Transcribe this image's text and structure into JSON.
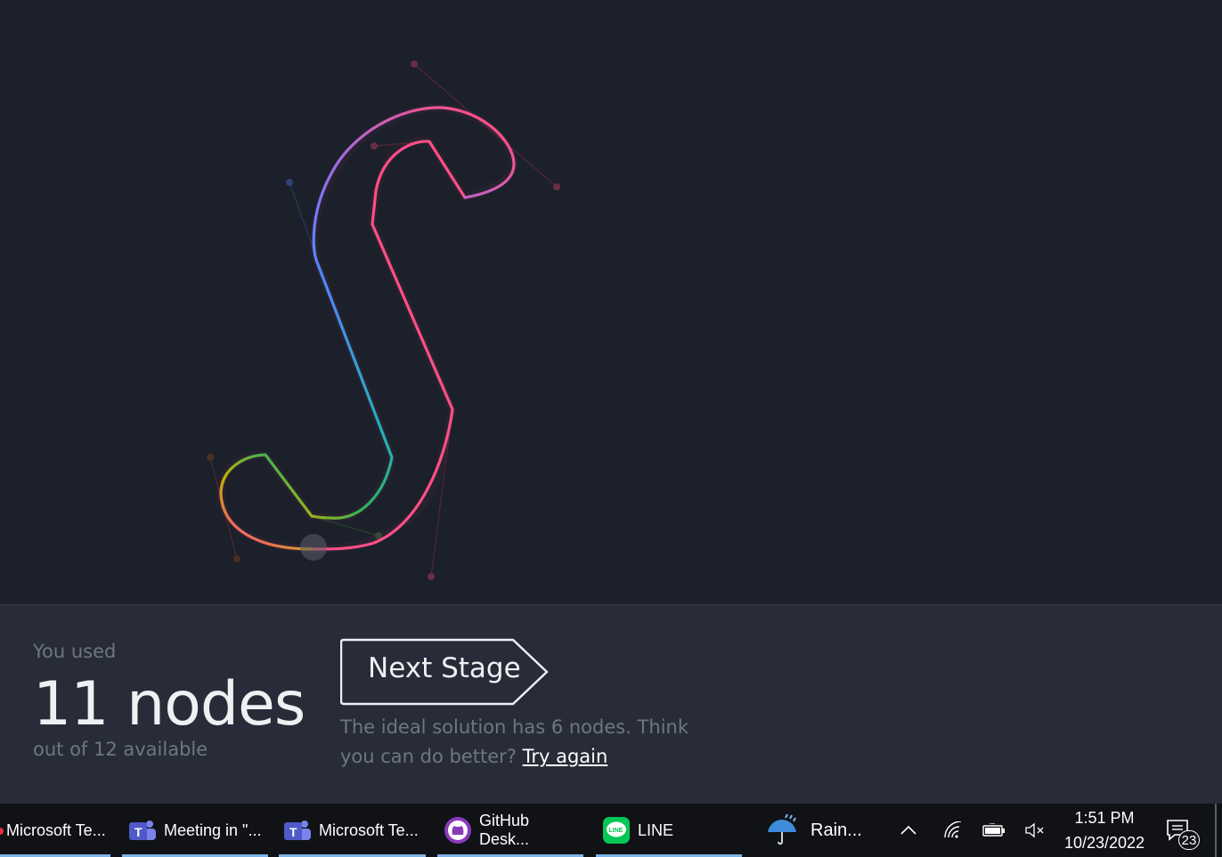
{
  "result": {
    "used_label": "You used",
    "node_count": "11 nodes",
    "available": "out of 12 available",
    "next_stage_label": "Next Stage",
    "hint_text": "The ideal solution has 6 nodes. Think you can do better?",
    "try_again": "Try again"
  },
  "taskbar": {
    "apps": [
      {
        "label": "Microsoft Te...",
        "icon": "teams-icon"
      },
      {
        "label": "Meeting in \"...",
        "icon": "teams-icon"
      },
      {
        "label": "Microsoft Te...",
        "icon": "teams-icon"
      },
      {
        "label": "GitHub Desk...",
        "icon": "github-icon"
      },
      {
        "label": "LINE",
        "icon": "line-icon"
      }
    ],
    "weather": "Rain...",
    "time": "1:51 PM",
    "date": "10/23/2022",
    "notifications": "23"
  },
  "colors": {
    "background": "#1c202b",
    "panel": "#272c38",
    "taskbar": "#101216",
    "shape_stroke": "#ff4f85"
  }
}
